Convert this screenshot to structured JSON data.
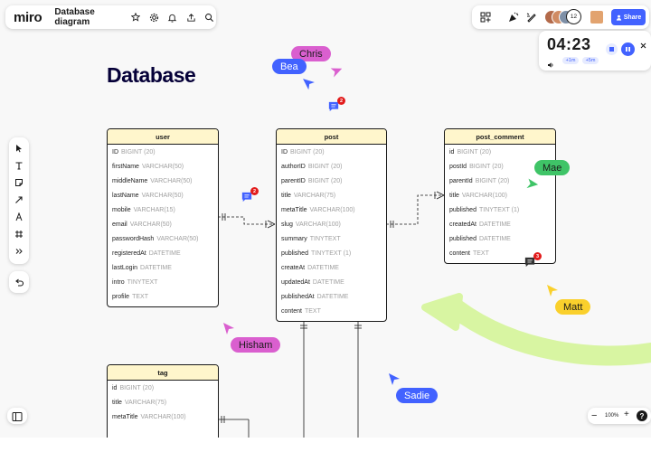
{
  "app": {
    "logo": "miro",
    "board_title": "Database diagram",
    "share_label": "Share",
    "collaborator_count": "12"
  },
  "timer": {
    "minutes": "04",
    "seconds": "23",
    "add_1m": "+1m",
    "add_5m": "+5m"
  },
  "zoom": {
    "level": "100%",
    "minus": "−",
    "plus": "+",
    "help": "?"
  },
  "heading": "Database",
  "tables": {
    "user": {
      "title": "user",
      "rows": [
        {
          "name": "ID",
          "type": "BIGINT (20)"
        },
        {
          "name": "firstName",
          "type": "VARCHAR(50)"
        },
        {
          "name": "middleName",
          "type": "VARCHAR(50)"
        },
        {
          "name": "lastName",
          "type": "VARCHAR(50)"
        },
        {
          "name": "mobile",
          "type": "VARCHAR(15)"
        },
        {
          "name": "email",
          "type": "VARCHAR(50)"
        },
        {
          "name": "passwordHash",
          "type": "VARCHAR(50)"
        },
        {
          "name": "registeredAt",
          "type": "DATETIME"
        },
        {
          "name": "lastLogin",
          "type": "DATETIME"
        },
        {
          "name": "intro",
          "type": "TINYTEXT"
        },
        {
          "name": "profile",
          "type": "TEXT"
        }
      ]
    },
    "post": {
      "title": "post",
      "rows": [
        {
          "name": "ID",
          "type": "BIGINT (20)"
        },
        {
          "name": "authorID",
          "type": "BIGINT (20)"
        },
        {
          "name": "parentID",
          "type": "BIGINT (20)"
        },
        {
          "name": "title",
          "type": "VARCHAR(75)"
        },
        {
          "name": "metaTitle",
          "type": "VARCHAR(100)"
        },
        {
          "name": "slug",
          "type": "VARCHAR(100)"
        },
        {
          "name": "summary",
          "type": "TINYTEXT"
        },
        {
          "name": "published",
          "type": "TINYTEXT (1)"
        },
        {
          "name": "createAt",
          "type": "DATETIME"
        },
        {
          "name": "updatedAt",
          "type": "DATETIME"
        },
        {
          "name": "publishedAt",
          "type": "DATETIME"
        },
        {
          "name": "content",
          "type": "TEXT"
        }
      ]
    },
    "post_comment": {
      "title": "post_comment",
      "rows": [
        {
          "name": "id",
          "type": "BIGINT (20)"
        },
        {
          "name": "postId",
          "type": "BIGINT (20)"
        },
        {
          "name": "parentId",
          "type": "BIGINT (20)"
        },
        {
          "name": "title",
          "type": "VARCHAR(100)"
        },
        {
          "name": "published",
          "type": "TINYTEXT (1)"
        },
        {
          "name": "createdAt",
          "type": "DATETIME"
        },
        {
          "name": "published",
          "type": "DATETIME"
        },
        {
          "name": "content",
          "type": "TEXT"
        }
      ]
    },
    "tag": {
      "title": "tag",
      "rows": [
        {
          "name": "id",
          "type": "BIGINT (20)"
        },
        {
          "name": "title",
          "type": "VARCHAR(75)"
        },
        {
          "name": "metaTitle",
          "type": "VARCHAR(100)"
        }
      ]
    }
  },
  "comment_badges": {
    "near_title": "2",
    "near_user": "2",
    "near_post_comment": "3"
  },
  "cursors": [
    {
      "name": "Chris",
      "color": "#da5fcf"
    },
    {
      "name": "Bea",
      "color": "#4262ff"
    },
    {
      "name": "Mae",
      "color": "#3fc467"
    },
    {
      "name": "Matt",
      "color": "#fad02c"
    },
    {
      "name": "Hisham",
      "color": "#da5fcf"
    },
    {
      "name": "Sadie",
      "color": "#4262ff"
    }
  ],
  "colors": {
    "accent": "#4262ff",
    "table_header": "#fff6cc",
    "arrow": "#d8f5a2",
    "heading": "#050038"
  },
  "icons": [
    "settings-icon",
    "bell-icon",
    "upload-icon",
    "search-icon",
    "star-icon",
    "apps-icon",
    "celebrate-icon",
    "pen-cursor-icon",
    "select-tool-icon",
    "text-tool-icon",
    "sticky-note-icon",
    "line-tool-icon",
    "pen-tool-icon",
    "frame-tool-icon",
    "more-tools-icon",
    "undo-icon",
    "frames-panel-icon",
    "volume-icon",
    "stop-icon",
    "pause-icon",
    "close-icon"
  ]
}
